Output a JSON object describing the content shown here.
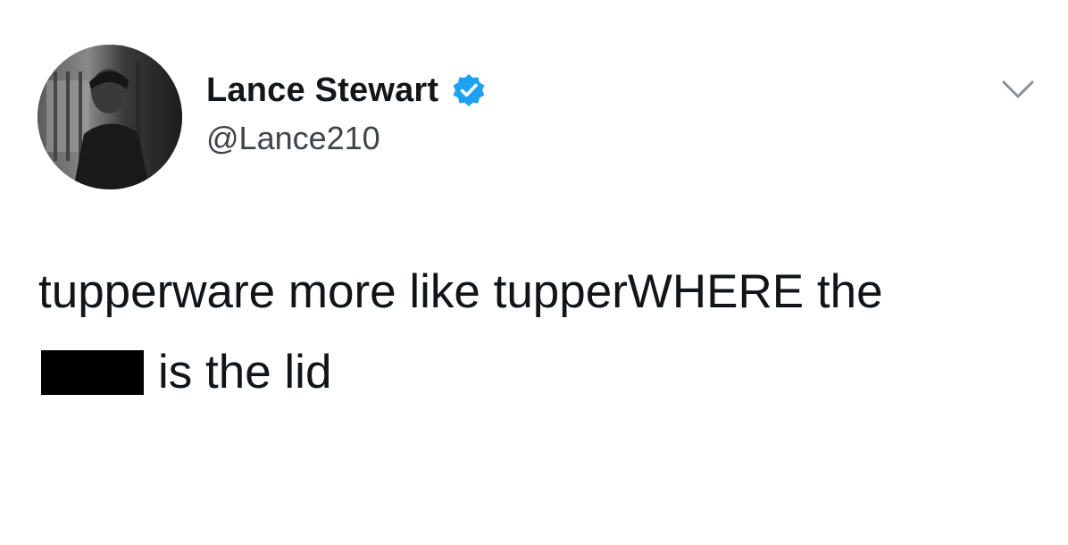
{
  "tweet": {
    "author": {
      "display_name": "Lance Stewart",
      "handle": "@Lance210",
      "verified": true,
      "verified_color": "#1da1f2"
    },
    "text": {
      "line1": "tupperware more like tupperWHERE the",
      "line2_after_redaction": "is the lid",
      "redacted_word": true
    },
    "menu_icon": "chevron-down-icon"
  }
}
